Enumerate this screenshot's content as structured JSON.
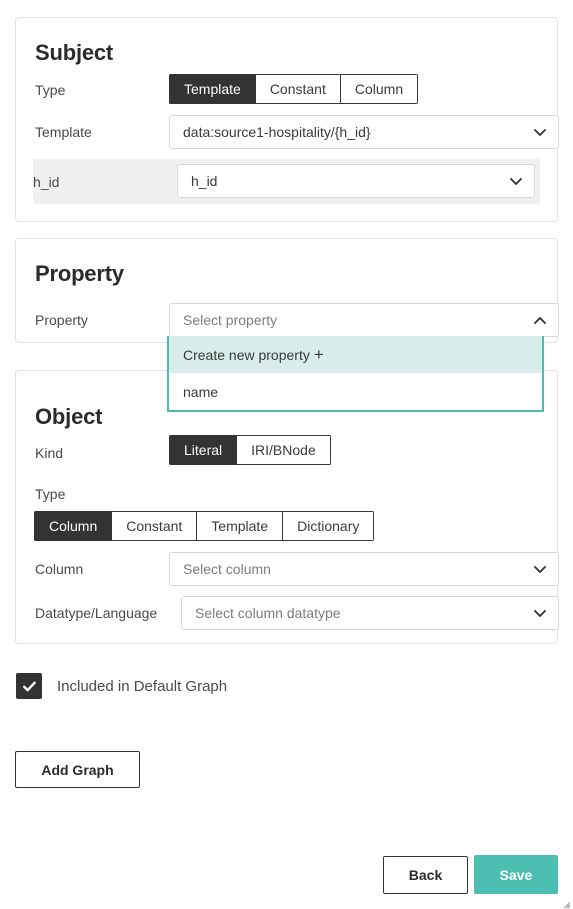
{
  "subject": {
    "title": "Subject",
    "type_label": "Type",
    "type_options": [
      "Template",
      "Constant",
      "Column"
    ],
    "type_selected": "Template",
    "template_label": "Template",
    "template_value": "data:source1-hospitality/{h_id}",
    "variable_label": "h_id",
    "variable_value": "h_id"
  },
  "property": {
    "title": "Property",
    "property_label": "Property",
    "property_placeholder": "Select property",
    "dropdown_open": true,
    "options": [
      {
        "label": "Create new property",
        "has_plus": true,
        "plus": "+",
        "highlighted": true
      },
      {
        "label": "name",
        "has_plus": false,
        "plus": "",
        "highlighted": false
      }
    ]
  },
  "object": {
    "title": "Object",
    "kind_label": "Kind",
    "kind_options": [
      "Literal",
      "IRI/BNode"
    ],
    "kind_selected": "Literal",
    "type_label": "Type",
    "type_options": [
      "Column",
      "Constant",
      "Template",
      "Dictionary"
    ],
    "type_selected": "Column",
    "column_label": "Column",
    "column_placeholder": "Select column",
    "datatype_label": "Datatype/Language",
    "datatype_placeholder": "Select column datatype"
  },
  "footer": {
    "default_graph_label": "Included in Default Graph",
    "default_graph_checked": true,
    "add_graph_label": "Add Graph",
    "back_label": "Back",
    "save_label": "Save"
  },
  "colors": {
    "accent": "#4dbfb0",
    "accent_light": "#d9eeea",
    "dark": "#333333",
    "border": "#e2e2e2",
    "strip": "#f0f0f0"
  }
}
